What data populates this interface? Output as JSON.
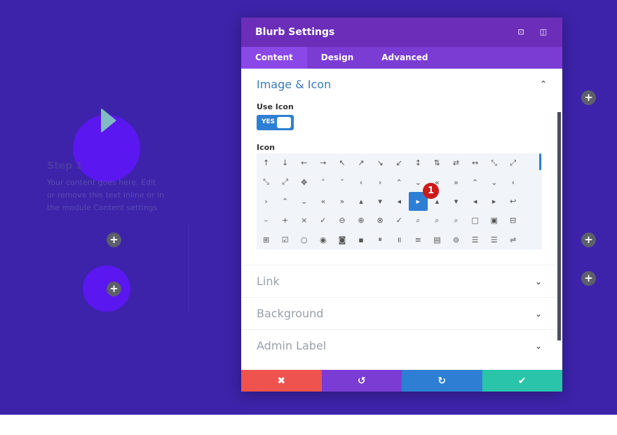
{
  "canvas": {
    "step_title": "Step 1",
    "step_text": "Your content goes here. Edit or remove this text inline or in the module Content settings",
    "add_icon": "+"
  },
  "modal": {
    "title": "Blurb Settings",
    "header_icons": [
      "fullscreen-icon",
      "sidebar-icon"
    ],
    "header_glyphs": [
      "⊡",
      "◫"
    ],
    "tabs": [
      {
        "label": "Content"
      },
      {
        "label": "Design"
      },
      {
        "label": "Advanced"
      }
    ],
    "section": {
      "title": "Image & Icon",
      "use_icon_label": "Use Icon",
      "toggle_label": "YES",
      "icon_label": "Icon",
      "selected_badge": "1",
      "icons": [
        "↑",
        "↓",
        "←",
        "→",
        "↖",
        "↗",
        "↘",
        "↙",
        "↕",
        "⇅",
        "⇄",
        "↔",
        "⤡",
        "⤢",
        "",
        "⤡",
        "⤢",
        "✥",
        "˄",
        "˅",
        "‹",
        "›",
        "⌃",
        "⌄",
        "«",
        "»",
        "⌃",
        "⌄",
        "‹",
        "",
        "›",
        "⌃",
        "⌄",
        "«",
        "»",
        "▴",
        "▾",
        "◂",
        "▸",
        "▴",
        "▾",
        "◂",
        "▸",
        "↩",
        "",
        "–",
        "+",
        "×",
        "✓",
        "⊖",
        "⊕",
        "⊗",
        "✓",
        "⌕",
        "⌕",
        "⌕",
        "□",
        "▣",
        "⊟",
        "",
        "⊞",
        "☑",
        "○",
        "◉",
        "◙",
        "▪",
        "⏸",
        "॥",
        "≡",
        "▤",
        "⊜",
        "☰",
        "☰",
        "⇌",
        ""
      ]
    },
    "collapsed": [
      {
        "title": "Link"
      },
      {
        "title": "Background"
      },
      {
        "title": "Admin Label"
      }
    ],
    "footer": {
      "cancel": "✖",
      "undo": "↺",
      "redo": "↻",
      "save": "✔"
    },
    "colors": {
      "cancel": "#ef5350",
      "undo": "#7b3cd4",
      "redo": "#2e7fd3",
      "save": "#29c4a9",
      "accent": "#2e7fd3",
      "section_title": "#3a7bbf"
    }
  }
}
